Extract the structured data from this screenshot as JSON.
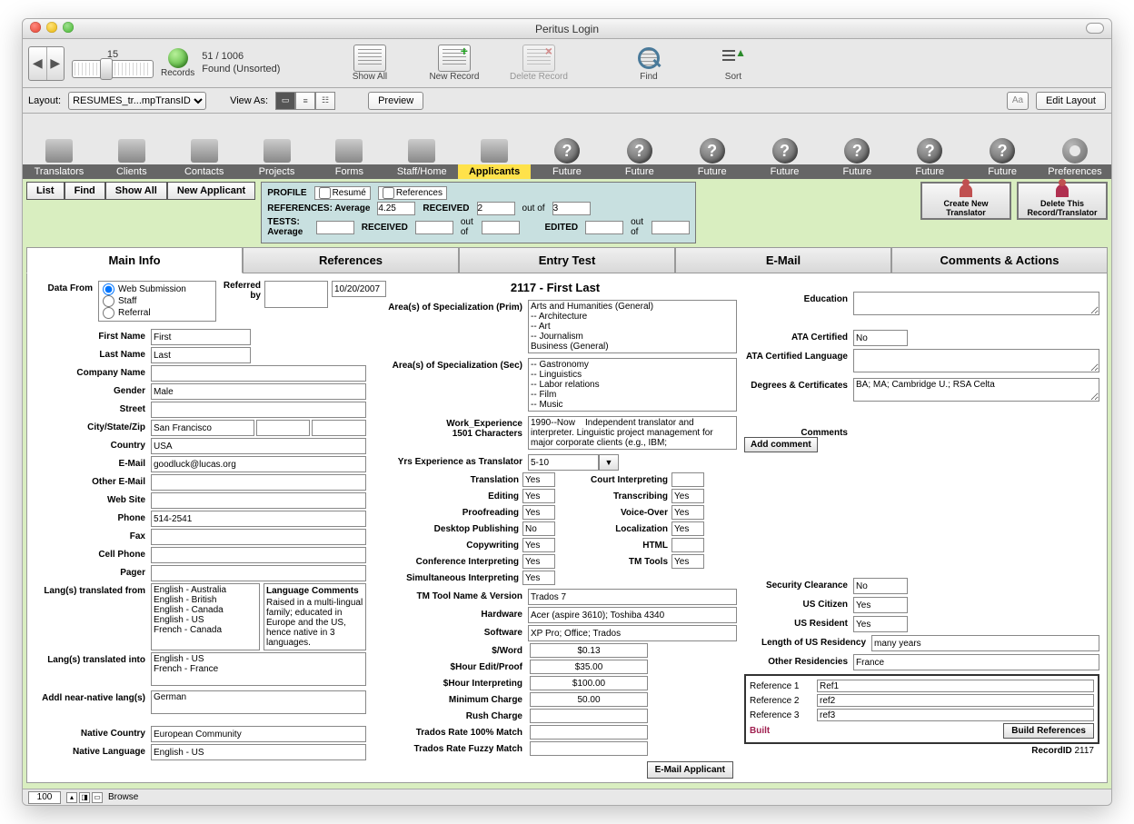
{
  "window": {
    "title": "Peritus Login"
  },
  "toolbar1": {
    "record_slider": "15",
    "found": "51 / 1006",
    "found_sub": "Found (Unsorted)",
    "records_label": "Records",
    "show_all": "Show All",
    "new_record": "New Record",
    "delete_record": "Delete Record",
    "find": "Find",
    "sort": "Sort"
  },
  "toolbar2": {
    "layout_label": "Layout:",
    "layout_value": "RESUMES_tr...mpTransID",
    "view_as": "View As:",
    "preview": "Preview",
    "edit_layout": "Edit Layout",
    "aa": "Aa"
  },
  "iconbar": {
    "items": [
      "Translators",
      "Clients",
      "Contacts",
      "Projects",
      "Forms",
      "Staff/Home",
      "Applicants",
      "Future",
      "Future",
      "Future",
      "Future",
      "Future",
      "Future",
      "Future",
      "Preferences"
    ],
    "active_index": 6
  },
  "topbuttons": {
    "list": "List",
    "find": "Find",
    "show_all": "Show All",
    "new_applicant": "New Applicant"
  },
  "profile": {
    "profile_label": "PROFILE",
    "resume": "Resumé",
    "references": "References",
    "references_avg_label": "REFERENCES: Average",
    "references_avg": "4.25",
    "received1_label": "RECEIVED",
    "received1_a": "2",
    "outof": "out of",
    "received1_b": "3",
    "tests_avg_label": "TESTS: Average",
    "tests_avg": "",
    "received2_label": "RECEIVED",
    "received2_a": "",
    "received2_b": "",
    "edited_label": "EDITED",
    "edited_a": "",
    "edited_b": ""
  },
  "actions": {
    "create": "Create New\nTranslator",
    "delete": "Delete This\nRecord/Translator"
  },
  "tabs": [
    "Main Info",
    "References",
    "Entry Test",
    "E-Mail",
    "Comments & Actions"
  ],
  "header": "2117 - First Last",
  "colA": {
    "data_from_label": "Data From",
    "data_from_options": [
      "Web Submission",
      "Staff",
      "Referral"
    ],
    "data_from_selected": 0,
    "referred_by_label": "Referred by",
    "referred_by_value": "",
    "referred_date": "10/20/2007",
    "first_name_l": "First Name",
    "first_name": "First",
    "last_name_l": "Last Name",
    "last_name": "Last",
    "company_l": "Company Name",
    "company": "",
    "gender_l": "Gender",
    "gender": "Male",
    "street_l": "Street",
    "street": "",
    "csz_l": "City/State/Zip",
    "city": "San Francisco",
    "state": "",
    "zip": "",
    "country_l": "Country",
    "country": "USA",
    "email_l": "E-Mail",
    "email": "goodluck@lucas.org",
    "other_email_l": "Other E-Mail",
    "other_email": "",
    "website_l": "Web Site",
    "website": "",
    "phone_l": "Phone",
    "phone": "514-2541",
    "fax_l": "Fax",
    "fax": "",
    "cell_l": "Cell Phone",
    "cell": "",
    "pager_l": "Pager",
    "pager": "",
    "lang_from_l": "Lang(s) translated from",
    "lang_from": "English - Australia\nEnglish - British\nEnglish - Canada\nEnglish - US\nFrench - Canada",
    "lang_into_l": "Lang(s) translated into",
    "lang_into": "English - US\nFrench - France",
    "addl_lang_l": "Addl near-native lang(s)",
    "addl_lang": "German",
    "lang_comments_h": "Language Comments",
    "lang_comments": "Raised in a multi-lingual family; educated in Europe and the US, hence native in 3 languages.",
    "native_country_l": "Native Country",
    "native_country": "European Community",
    "native_lang_l": "Native Language",
    "native_lang": "English - US"
  },
  "colB": {
    "spec_prim_l": "Area(s) of Specialization (Prim)",
    "spec_prim": "Arts and Humanities (General)\n-- Architecture\n-- Art\n-- Journalism\nBusiness (General)",
    "spec_sec_l": "Area(s) of Specialization (Sec)",
    "spec_sec": "-- Gastronomy\n-- Linguistics\n-- Labor relations\n-- Film\n-- Music",
    "work_exp_l": "Work_Experience\n1501 Characters",
    "work_exp": "1990--Now    Independent translator and interpreter. Linguistic project management for major corporate clients (e.g., IBM;",
    "yrs_l": "Yrs Experience as Translator",
    "yrs": "5-10",
    "skills": {
      "translation_l": "Translation",
      "translation": "Yes",
      "editing_l": "Editing",
      "editing": "Yes",
      "proof_l": "Proofreading",
      "proof": "Yes",
      "dtp_l": "Desktop Publishing",
      "dtp": "No",
      "copy_l": "Copywriting",
      "copy": "Yes",
      "conf_l": "Conference Interpreting",
      "conf": "Yes",
      "sim_l": "Simultaneous Interpreting",
      "sim": "Yes",
      "court_l": "Court Interpreting",
      "court": "",
      "trans_l": "Transcribing",
      "trans": "Yes",
      "voice_l": "Voice-Over",
      "voice": "Yes",
      "local_l": "Localization",
      "local": "Yes",
      "html_l": "HTML",
      "html": "",
      "tmtools_l": "TM Tools",
      "tmtools": "Yes"
    },
    "tmname_l": "TM Tool Name & Version",
    "tmname": "Trados 7",
    "hardware_l": "Hardware",
    "hardware": "Acer (aspire 3610); Toshiba 4340",
    "software_l": "Software",
    "software": "XP Pro; Office; Trados",
    "perword_l": "$/Word",
    "perword": "$0.13",
    "hedit_l": "$Hour Edit/Proof",
    "hedit": "$35.00",
    "hinterp_l": "$Hour Interpreting",
    "hinterp": "$100.00",
    "min_l": "Minimum Charge",
    "min": "50.00",
    "rush_l": "Rush Charge",
    "rush": "",
    "trados100_l": "Trados Rate 100% Match",
    "trados100": "",
    "tradosfuzzy_l": "Trados Rate Fuzzy Match",
    "tradosfuzzy": "",
    "email_applicant": "E-Mail Applicant"
  },
  "colC": {
    "education_l": "Education",
    "education": "",
    "ata_cert_l": "ATA Certified",
    "ata_cert": "No",
    "ata_lang_l": "ATA Certified Language",
    "ata_lang": "",
    "degrees_l": "Degrees & Certificates",
    "degrees": "BA; MA; Cambridge U.; RSA Celta",
    "comments_l": "Comments",
    "add_comment": "Add comment",
    "sec_clear_l": "Security Clearance",
    "sec_clear": "No",
    "us_cit_l": "US Citizen",
    "us_cit": "Yes",
    "us_res_l": "US Resident",
    "us_res": "Yes",
    "len_res_l": "Length of US Residency",
    "len_res": "many years",
    "other_res_l": "Other Residencies",
    "other_res": "France",
    "ref1_l": "Reference 1",
    "ref1": "Ref1",
    "ref2_l": "Reference 2",
    "ref2": "ref2",
    "ref3_l": "Reference 3",
    "ref3": "ref3",
    "built": "Built",
    "build_refs": "Build References",
    "recordid_l": "RecordID",
    "recordid": "2117"
  },
  "footer": {
    "zoom": "100",
    "mode": "Browse"
  }
}
